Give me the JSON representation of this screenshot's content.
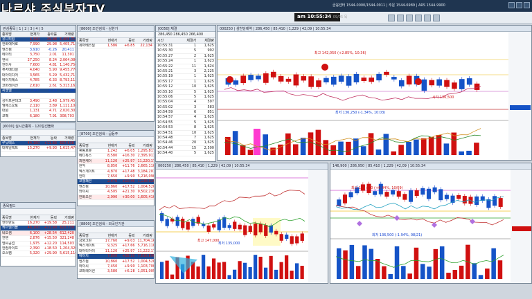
{
  "overlay_title": "나르샤 주식부자TV",
  "top_info": "금융센터 1544-0000/1544-0911 | 주문 1544-6989 | ARS 1544-9900",
  "clock": {
    "time": "am 10:55:34",
    "date": "09/05 목"
  },
  "watch": {
    "tabs": "관심종목 | 1 | 2 | 3 | 4 | 5",
    "headers": [
      "종목명",
      "현재가",
      "등락률",
      "거래량"
    ],
    "rows": [
      {
        "name": "유니티링",
        "price": "4,320",
        "rate": "29.98",
        "vol": "5,405,718",
        "dir": "up",
        "sel": true
      },
      {
        "name": "한화에어로",
        "price": "7,990",
        "rate": "29.98",
        "vol": "5,405,718",
        "dir": "up"
      },
      {
        "name": "엔즈컴",
        "price": "3,910",
        "rate": "-0.26",
        "vol": "20,411",
        "dir": "dn"
      },
      {
        "name": "에이티",
        "price": "3,750",
        "rate": "2.01",
        "vol": "11,301",
        "dir": "up"
      },
      {
        "name": "엔씨",
        "price": "27,250",
        "rate": "8.24",
        "vol": "2,064,080",
        "dir": "up"
      },
      {
        "name": "한미사",
        "price": "7,600",
        "rate": "4.81",
        "vol": "1,140,750",
        "dir": "up"
      },
      {
        "name": "퓨처메디컬",
        "price": "4,040",
        "rate": "5.90",
        "vol": "9,455,770",
        "dir": "up"
      },
      {
        "name": "대아미디어",
        "price": "3,565",
        "rate": "5.29",
        "vol": "5,432,711",
        "dir": "up"
      },
      {
        "name": "에이치에스",
        "price": "4,785",
        "rate": "6.33",
        "vol": "8,793,112",
        "dir": "up"
      },
      {
        "name": "코퍼레이션",
        "price": "2,610",
        "rate": "2.61",
        "vol": "5,313,162",
        "dir": "up"
      },
      {
        "name": "씨앤엘",
        "price": "21,900",
        "rate": "-0.28",
        "vol": "2,021,413",
        "dir": "dn",
        "sel": true
      },
      {
        "name": "",
        "price": "",
        "rate": "",
        "vol": "",
        "dir": "up"
      },
      {
        "name": "상아프론테크",
        "price": "3,490",
        "rate": "2.48",
        "vol": "1,979,451",
        "dir": "up"
      },
      {
        "name": "엠에스오토",
        "price": "2,110",
        "rate": "3.89",
        "vol": "1,111,108",
        "dir": "up"
      },
      {
        "name": "대원",
        "price": "1,131",
        "rate": "4.71",
        "vol": "2,020,303",
        "dir": "up"
      },
      {
        "name": "코펙",
        "price": "6,180",
        "rate": "7.91",
        "vol": "308,703",
        "dir": "up"
      }
    ]
  },
  "mini1": {
    "title": "[6000] 실시간종목 - 120일선돌파",
    "headers": [
      "종목명",
      "현재가",
      "등락",
      "거래량"
    ],
    "rows": [
      {
        "name": "루닛테스",
        "price": "44,150",
        "rate": "+11.66",
        "vol": "607,636",
        "dir": "up",
        "sel": true
      },
      {
        "name": "대제일렉트",
        "price": "15,270",
        "rate": "+9.93",
        "vol": "1,615,470",
        "dir": "up"
      }
    ]
  },
  "mini2": {
    "title": "종목필드",
    "headers": [
      "종목명",
      "현재가",
      "등락",
      "거래량"
    ],
    "rows": [
      {
        "name": "한미반도",
        "price": "16,270",
        "rate": "+19.58",
        "vol": "25,211",
        "dir": "up"
      },
      {
        "name": "케이엠더블",
        "price": "46,100",
        "rate": "+11.90",
        "vol": "627,739",
        "dir": "up",
        "sel": true
      },
      {
        "name": "네오셈",
        "price": "6,100",
        "rate": "+28.54",
        "vol": "612,420",
        "dir": "up",
        "hl": true
      },
      {
        "name": "한텐",
        "price": "2,876",
        "rate": "+15.50",
        "vol": "321,248",
        "dir": "up"
      },
      {
        "name": "엔씨공업",
        "price": "1,975",
        "rate": "+12.20",
        "vol": "114,503",
        "dir": "up"
      },
      {
        "name": "한컴라이프",
        "price": "2,390",
        "rate": "+18.50",
        "vol": "1,204,320",
        "dir": "up"
      },
      {
        "name": "오스템",
        "price": "5,320",
        "rate": "+29.90",
        "vol": "5,615,110",
        "dir": "up"
      }
    ]
  },
  "cond1": {
    "title": "[8600] 조건검색 - 상한가",
    "headers": [
      "종목명",
      "현재가",
      "등락",
      "거래량"
    ],
    "rows": [
      {
        "name": "세아베스틸",
        "price": "1,586",
        "rate": "+6.85",
        "vol": "22,134",
        "dir": "up"
      }
    ]
  },
  "cond2": {
    "title": "[8700] 조건검색 - 급등주",
    "headers": [
      "종목명",
      "현재가",
      "등락",
      "거래량"
    ],
    "rows": [
      {
        "name": "휴림로봇",
        "price": "1,242",
        "rate": "+6.05",
        "vol": "1,295,817",
        "dir": "up"
      },
      {
        "name": "메디톡스",
        "price": "8,580",
        "rate": "+16.30",
        "vol": "2,395,911",
        "dir": "up"
      },
      {
        "name": "피엔케이",
        "price": "11,120",
        "rate": "+25.97",
        "vol": "11,220,174",
        "dir": "up",
        "hl": true
      },
      {
        "name": "원익",
        "price": "8,850",
        "rate": "+11.76",
        "vol": "2,665,110",
        "dir": "up"
      },
      {
        "name": "엑스게이트",
        "price": "4,870",
        "rate": "+17.48",
        "vol": "3,184,201",
        "dir": "up"
      },
      {
        "name": "한미",
        "price": "7,650",
        "rate": "+9.90",
        "vol": "5,216,090",
        "dir": "up"
      },
      {
        "name": "코웰패션",
        "price": "2,476",
        "rate": "+10.46",
        "vol": "1,138,020",
        "dir": "up",
        "sel": true
      },
      {
        "name": "엔즈컴",
        "price": "10,860",
        "rate": "+17.52",
        "vol": "1,004,520",
        "dir": "up"
      },
      {
        "name": "와이씨",
        "price": "4,505",
        "rate": "+21.30",
        "vol": "9,502,230",
        "dir": "up"
      },
      {
        "name": "한화오션",
        "price": "2,990",
        "rate": "+30.00",
        "vol": "1,605,410",
        "dir": "up",
        "hl": true
      }
    ]
  },
  "cond3": {
    "title": "[8800] 조건검색 - 외국인기관",
    "headers": [
      "종목명",
      "현재가",
      "등락",
      "거래량"
    ],
    "rows": [
      {
        "name": "금양그린",
        "price": "17,760",
        "rate": "+9.03",
        "vol": "11,704,161",
        "dir": "up"
      },
      {
        "name": "엑스게이트",
        "price": "9,325",
        "rate": "+17.66",
        "vol": "5,716,110",
        "dir": "up"
      },
      {
        "name": "대아티아이",
        "price": "11,120",
        "rate": "+25.97",
        "vol": "11,222,174",
        "dir": "up"
      },
      {
        "name": "에이치",
        "price": "7,850",
        "rate": "+28.10",
        "vol": "7,616,690",
        "dir": "up",
        "sel": true
      },
      {
        "name": "엔즈컴",
        "price": "10,860",
        "rate": "+17.52",
        "vol": "1,004,520",
        "dir": "up"
      },
      {
        "name": "와이씨",
        "price": "7,450",
        "rate": "+9.90",
        "vol": "1,103,700",
        "dir": "up"
      },
      {
        "name": "코퍼레이션",
        "price": "3,580",
        "rate": "+6.28",
        "vol": "1,051,005",
        "dir": "up"
      }
    ]
  },
  "ticks": {
    "title": "[0050] 체결",
    "prices": [
      "286,450",
      "286,450",
      "266,400"
    ],
    "headers": [
      "시간",
      "체결가",
      "체결량"
    ],
    "rows": [
      {
        "t": "10:55:31",
        "p": "1",
        "v": "1,625"
      },
      {
        "t": "10:55:30",
        "p": "5",
        "v": "992"
      },
      {
        "t": "10:55:27",
        "p": "2",
        "v": "1,625"
      },
      {
        "t": "10:55:24",
        "p": "1",
        "v": "1,623"
      },
      {
        "t": "10:55:22",
        "p": "11",
        "v": "1,624"
      },
      {
        "t": "10:55:21",
        "p": "3",
        "v": "2,225"
      },
      {
        "t": "10:55:19",
        "p": "1",
        "v": "1,625"
      },
      {
        "t": "10:55:17",
        "p": "1",
        "v": "1,625"
      },
      {
        "t": "10:55:12",
        "p": "10",
        "v": "1,625"
      },
      {
        "t": "10:55:10",
        "p": "5",
        "v": "1,625"
      },
      {
        "t": "10:55:06",
        "p": "5",
        "v": "1,625"
      },
      {
        "t": "10:55:04",
        "p": "4",
        "v": "597"
      },
      {
        "t": "10:55:02",
        "p": "3",
        "v": "583"
      },
      {
        "t": "10:54:59",
        "p": "6",
        "v": "851"
      },
      {
        "t": "10:54:57",
        "p": "4",
        "v": "1,625"
      },
      {
        "t": "10:54:55",
        "p": "5",
        "v": "1,625"
      },
      {
        "t": "10:54:53",
        "p": "8",
        "v": "1,625"
      },
      {
        "t": "10:54:51",
        "p": "10",
        "v": "1,625"
      },
      {
        "t": "10:54:48",
        "p": "7",
        "v": "1,625"
      },
      {
        "t": "10:54:46",
        "p": "20",
        "v": "1,625"
      },
      {
        "t": "10:54:44",
        "p": "15",
        "v": "2,500"
      },
      {
        "t": "10:54:40",
        "p": "5",
        "v": "1,625"
      }
    ]
  },
  "charts": {
    "main": {
      "header": "000250 | 삼천당제약 | 286,450 | 85,410 | 1,229 | 42,09 | 10:55:34",
      "labels": [
        "최고 142,050 (+2.85%, 10:36)",
        "시가 136,500",
        "최저 136,250 (-1.34%, 10:03)"
      ]
    },
    "bottom_left": {
      "header": "000250 | 286,450 | 85,410 | 1,229 | 42,09 | 10:55:34",
      "labels": [
        "최고 147,000",
        "최저 135,000"
      ]
    },
    "bottom_right": {
      "header": "146,900 | 286,950 | 85,410 | 1,229 | 42,09 | 10:55:34",
      "labels": [
        "최고 147,000 (+6.44%, 10/09)",
        "최저 136,500 (-1.94%, 08/21)"
      ]
    }
  },
  "colors": {
    "up": "#d01010",
    "down": "#1040d0",
    "title_bar": "#1f3550"
  }
}
